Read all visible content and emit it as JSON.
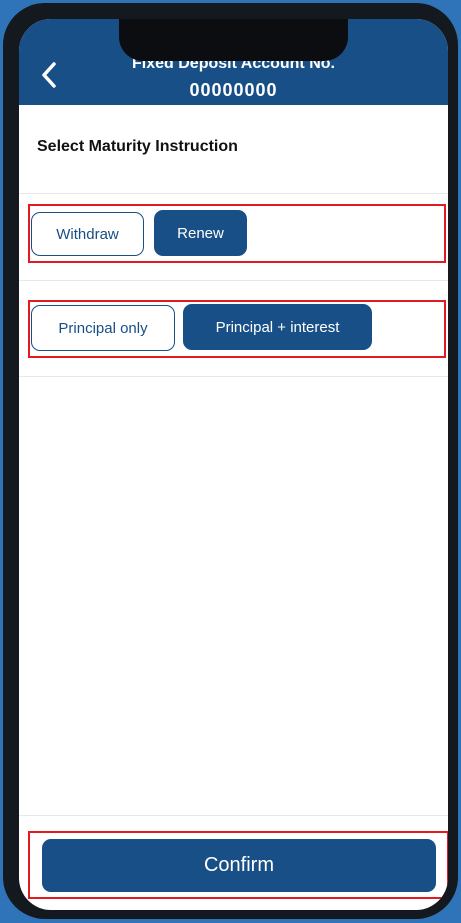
{
  "header": {
    "back_icon": "chevron-left-icon",
    "title_line1": "Fixed Deposit Account No.",
    "title_line2": "00000000"
  },
  "section": {
    "title": "Select Maturity Instruction"
  },
  "maturity_action": {
    "options": [
      "Withdraw",
      "Renew"
    ],
    "selected": "Renew"
  },
  "renewal_type": {
    "options": [
      "Principal only",
      "Principal + interest"
    ],
    "selected": "Principal + interest"
  },
  "footer": {
    "confirm_label": "Confirm"
  },
  "colors": {
    "primary": "#174f86",
    "highlight_outline": "#e01b24",
    "background": "#2f74b8"
  }
}
